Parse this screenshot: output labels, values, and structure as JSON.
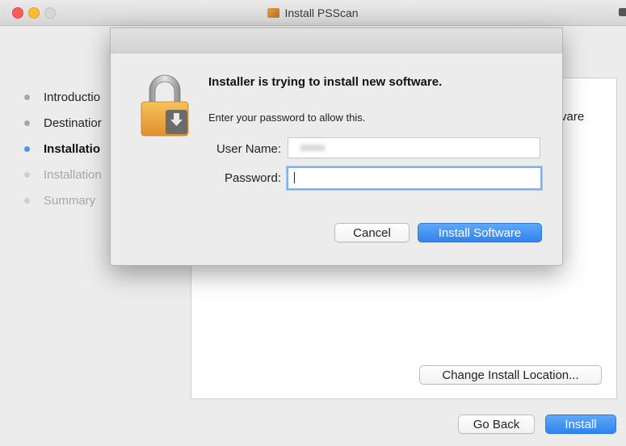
{
  "window": {
    "title": "Install PSScan",
    "steps": [
      {
        "label": "Introductio",
        "state": "done"
      },
      {
        "label": "Destinatior",
        "state": "done"
      },
      {
        "label": "Installatio",
        "state": "current"
      },
      {
        "label": "Installation",
        "state": "future"
      },
      {
        "label": "Summary",
        "state": "future"
      }
    ],
    "pane_text_fragment": "vare",
    "change_location_label": "Change Install Location...",
    "go_back_label": "Go Back",
    "install_label": "Install"
  },
  "dialog": {
    "title": "Installer is trying to install new software.",
    "message": "Enter your password to allow this.",
    "username_label": "User Name:",
    "password_label": "Password:",
    "cancel_label": "Cancel",
    "install_software_label": "Install Software"
  },
  "colors": {
    "accent_blue": "#2f84ee",
    "close_red": "#fc5f57",
    "minimize_yellow": "#fdbc2f"
  },
  "icons": {
    "dialog_icon": "lock-installer-icon",
    "title_icon": "package-icon"
  }
}
